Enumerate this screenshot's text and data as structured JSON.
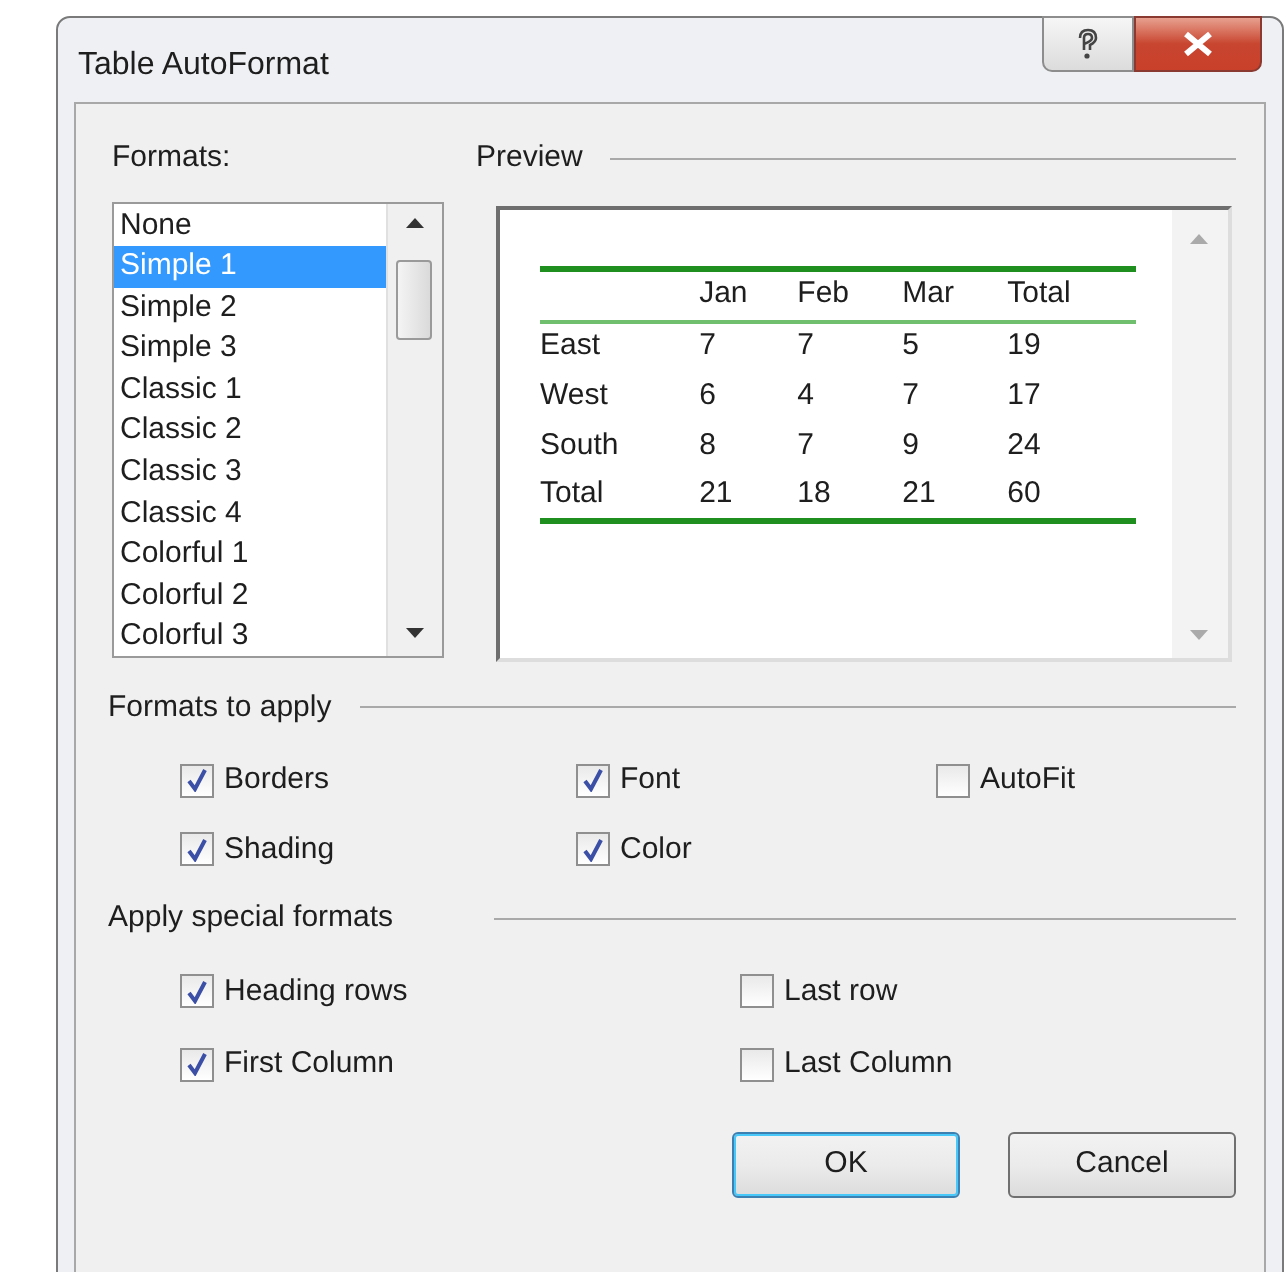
{
  "window": {
    "title": "Table AutoFormat"
  },
  "formats": {
    "label": "Formats:",
    "items": [
      {
        "label": "None",
        "selected": false
      },
      {
        "label": "Simple 1",
        "selected": true
      },
      {
        "label": "Simple 2",
        "selected": false
      },
      {
        "label": "Simple 3",
        "selected": false
      },
      {
        "label": "Classic 1",
        "selected": false
      },
      {
        "label": "Classic 2",
        "selected": false
      },
      {
        "label": "Classic 3",
        "selected": false
      },
      {
        "label": "Classic 4",
        "selected": false
      },
      {
        "label": "Colorful 1",
        "selected": false
      },
      {
        "label": "Colorful 2",
        "selected": false
      },
      {
        "label": "Colorful 3",
        "selected": false
      }
    ]
  },
  "preview": {
    "label": "Preview",
    "columns": [
      "Jan",
      "Feb",
      "Mar",
      "Total"
    ],
    "rows": [
      {
        "label": "East",
        "values": [
          "7",
          "7",
          "5",
          "19"
        ]
      },
      {
        "label": "West",
        "values": [
          "6",
          "4",
          "7",
          "17"
        ]
      },
      {
        "label": "South",
        "values": [
          "8",
          "7",
          "9",
          "24"
        ]
      },
      {
        "label": "Total",
        "values": [
          "21",
          "18",
          "21",
          "60"
        ]
      }
    ]
  },
  "formats_to_apply": {
    "label": "Formats to apply",
    "options": [
      {
        "label": "Borders",
        "checked": true
      },
      {
        "label": "Font",
        "checked": true
      },
      {
        "label": "AutoFit",
        "checked": false
      },
      {
        "label": "Shading",
        "checked": true
      },
      {
        "label": "Color",
        "checked": true
      }
    ]
  },
  "special_formats": {
    "label": "Apply special formats",
    "options": [
      {
        "label": "Heading rows",
        "checked": true
      },
      {
        "label": "Last row",
        "checked": false
      },
      {
        "label": "First Column",
        "checked": true
      },
      {
        "label": "Last Column",
        "checked": false
      }
    ]
  },
  "buttons": [
    {
      "label": "OK",
      "default": true
    },
    {
      "label": "Cancel",
      "default": false
    }
  ]
}
